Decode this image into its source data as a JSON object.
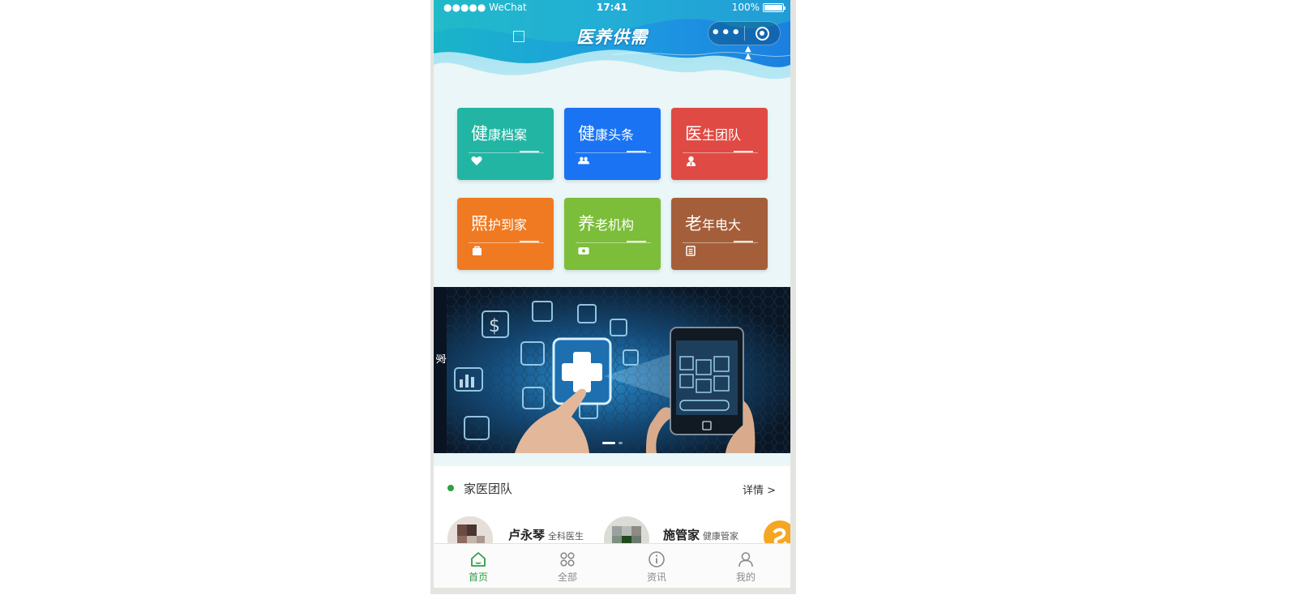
{
  "status_bar": {
    "carrier": "●●●●● WeChat",
    "time": "17:41",
    "battery": "100%"
  },
  "nav": {
    "title": "医养供需",
    "more_label": "•••"
  },
  "colors": {
    "accent_green": "#2ea043",
    "tile_teal": "#22b5a4",
    "tile_blue": "#1a73f3",
    "tile_red": "#e04a44",
    "tile_orange": "#f07a22",
    "tile_green": "#7cbd3a",
    "tile_brown": "#a45f3a"
  },
  "tiles": [
    {
      "first": "健",
      "rest": "康档案",
      "icon": "heart-icon"
    },
    {
      "first": "健",
      "rest": "康头条",
      "icon": "people-icon"
    },
    {
      "first": "医",
      "rest": "生团队",
      "icon": "doctor-icon"
    },
    {
      "first": "照",
      "rest": "护到家",
      "icon": "bag-icon"
    },
    {
      "first": "养",
      "rest": "老机构",
      "icon": "card-icon"
    },
    {
      "first": "老",
      "rest": "年电大",
      "icon": "book-icon"
    }
  ],
  "banner": {
    "slides": 2,
    "active_index": 0
  },
  "team": {
    "title": "家医团队",
    "detail_label": "详情 >",
    "members": [
      {
        "name": "卢永琴",
        "role": "全科医生"
      },
      {
        "name": "施管家",
        "role": "健康管家"
      }
    ]
  },
  "tabbar": [
    {
      "label": "首页",
      "icon": "home-icon",
      "active": true
    },
    {
      "label": "全部",
      "icon": "grid-icon",
      "active": false
    },
    {
      "label": "资讯",
      "icon": "info-icon",
      "active": false
    },
    {
      "label": "我的",
      "icon": "user-icon",
      "active": false
    }
  ]
}
